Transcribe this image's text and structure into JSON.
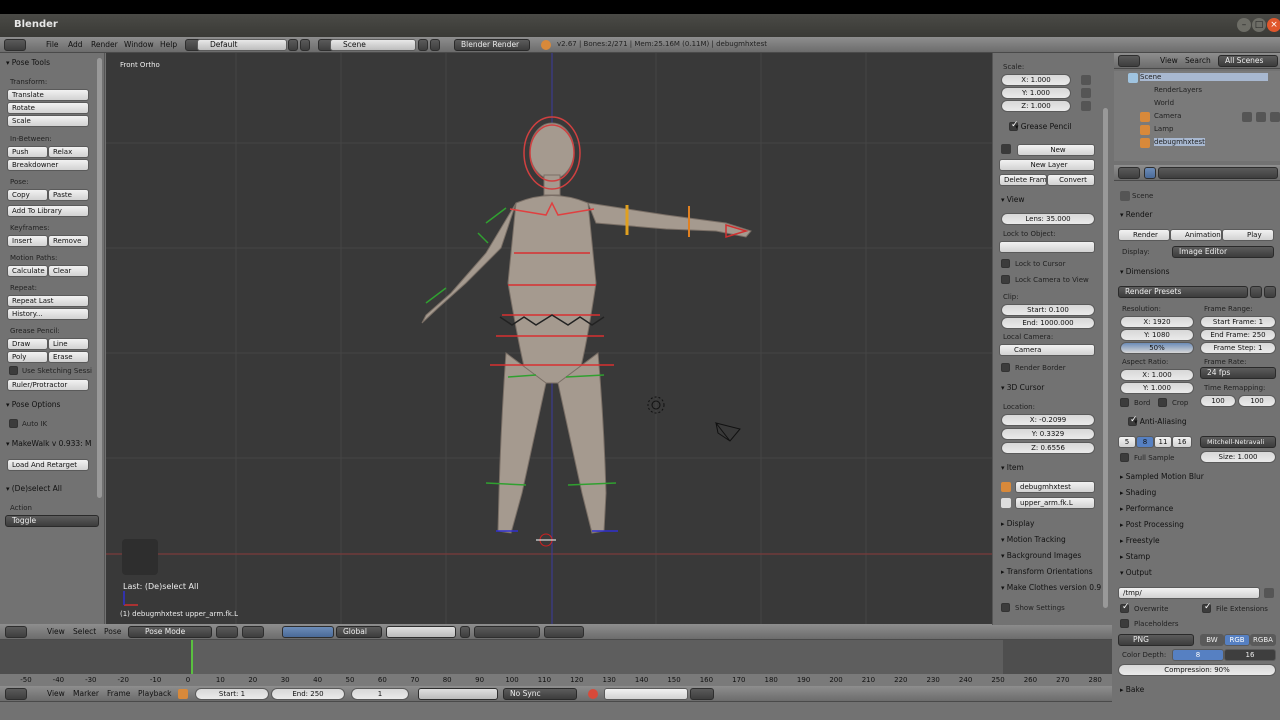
{
  "window": {
    "title": "Blender"
  },
  "info": {
    "editor_icon": "info-icon",
    "menus": [
      "File",
      "Add",
      "Render",
      "Window",
      "Help"
    ],
    "screen": "Default",
    "scene": "Scene",
    "engine": "Blender Render",
    "stats": "v2.67 | Bones:2/271 | Mem:25.16M (0.11M) | debugmhxtest"
  },
  "tools": {
    "pose_tools": "Pose Tools",
    "transform_label": "Transform:",
    "translate": "Translate",
    "rotate": "Rotate",
    "scale": "Scale",
    "inbetween_label": "In-Between:",
    "push": "Push",
    "relax": "Relax",
    "breakdowner": "Breakdowner",
    "pose_label": "Pose:",
    "copy": "Copy",
    "paste": "Paste",
    "add_to_library": "Add To Library",
    "keyframes_label": "Keyframes:",
    "insert": "Insert",
    "remove": "Remove",
    "motion_paths_label": "Motion Paths:",
    "calculate": "Calculate",
    "clear": "Clear",
    "repeat_label": "Repeat:",
    "repeat_last": "Repeat Last",
    "history": "History...",
    "grease_pencil_label": "Grease Pencil:",
    "draw": "Draw",
    "line": "Line",
    "poly": "Poly",
    "erase": "Erase",
    "use_sketching": "Use Sketching Sessi",
    "ruler": "Ruler/Protractor",
    "pose_options": "Pose Options",
    "auto_ik": "Auto IK",
    "makewalk": "MakeWalk v 0.933: M",
    "load_retarget": "Load And Retarget",
    "deselect_all": "(De)select All",
    "action_label": "Action",
    "action_value": "Toggle"
  },
  "viewport": {
    "view_name": "Front Ortho",
    "last_op": "Last: (De)select All",
    "active": "(1) debugmhxtest upper_arm.fk.L"
  },
  "viewport_header": {
    "menus": [
      "View",
      "Select",
      "Pose"
    ],
    "mode": "Pose Mode",
    "orientation": "Global"
  },
  "npanel": {
    "scale_label": "Scale:",
    "scale_x": "X: 1.000",
    "scale_y": "Y: 1.000",
    "scale_z": "Z: 1.000",
    "grease_pencil": "Grease Pencil",
    "new": "New",
    "new_layer": "New Layer",
    "delete_frame": "Delete Frame",
    "convert": "Convert",
    "view": "View",
    "lens": "Lens: 35.000",
    "lock_to_object": "Lock to Object:",
    "lock_to_cursor": "Lock to Cursor",
    "lock_camera": "Lock Camera to View",
    "clip_label": "Clip:",
    "clip_start": "Start: 0.100",
    "clip_end": "End: 1000.000",
    "local_camera_label": "Local Camera:",
    "local_camera": "Camera",
    "render_border": "Render Border",
    "cursor": "3D Cursor",
    "location_label": "Location:",
    "loc_x": "X: -0.2099",
    "loc_y": "Y: 0.3329",
    "loc_z": "Z: 0.6556",
    "item": "Item",
    "item_object": "debugmhxtest",
    "item_bone": "upper_arm.fk.L",
    "display": "Display",
    "motion_tracking": "Motion Tracking",
    "background_images": "Background Images",
    "transform_orientations": "Transform Orientations",
    "make_clothes": "Make Clothes version 0.9",
    "show_settings": "Show Settings"
  },
  "outliner": {
    "menus": [
      "View",
      "Search"
    ],
    "filter": "All Scenes",
    "items": [
      "Scene",
      "RenderLayers",
      "World",
      "Camera",
      "Lamp",
      "debugmhxtest"
    ]
  },
  "properties": {
    "breadcrumb": "Scene",
    "render": "Render",
    "render_btn": "Render",
    "animation_btn": "Animation",
    "play_btn": "Play",
    "display_label": "Display:",
    "display_value": "Image Editor",
    "dimensions": "Dimensions",
    "render_presets": "Render Presets",
    "resolution_label": "Resolution:",
    "res_x": "X: 1920",
    "res_y": "Y: 1080",
    "res_pct": "50%",
    "frame_range_label": "Frame Range:",
    "start_frame": "Start Frame: 1",
    "end_frame": "End Frame: 250",
    "frame_step": "Frame Step: 1",
    "aspect_label": "Aspect Ratio:",
    "asp_x": "X: 1.000",
    "asp_y": "Y: 1.000",
    "frame_rate_label": "Frame Rate:",
    "frame_rate": "24 fps",
    "bord": "Bord",
    "crop": "Crop",
    "time_remap_label": "Time Remapping:",
    "remap_old": "100",
    "remap_new": "100",
    "anti_aliasing": "Anti-Aliasing",
    "aa_samples": [
      "5",
      "8",
      "11",
      "16"
    ],
    "aa_filter": "Mitchell-Netravali",
    "full_sample": "Full Sample",
    "aa_size": "Size: 1.000",
    "sampled_motion_blur": "Sampled Motion Blur",
    "shading": "Shading",
    "performance": "Performance",
    "post_processing": "Post Processing",
    "freestyle": "Freestyle",
    "stamp": "Stamp",
    "output": "Output",
    "output_path": "/tmp/",
    "overwrite": "Overwrite",
    "file_extensions": "File Extensions",
    "placeholders": "Placeholders",
    "format": "PNG",
    "bw": "BW",
    "rgb": "RGB",
    "rgba": "RGBA",
    "color_depth_label": "Color Depth:",
    "depth_8": "8",
    "depth_16": "16",
    "compression": "Compression: 90%",
    "bake": "Bake"
  },
  "timeline": {
    "ticks": [
      "-50",
      "-40",
      "-30",
      "-20",
      "-10",
      "0",
      "10",
      "20",
      "30",
      "40",
      "50",
      "60",
      "70",
      "80",
      "90",
      "100",
      "110",
      "120",
      "130",
      "140",
      "150",
      "160",
      "170",
      "180",
      "190",
      "200",
      "210",
      "220",
      "230",
      "240",
      "250",
      "260",
      "270",
      "280"
    ],
    "menus": [
      "View",
      "Marker",
      "Frame",
      "Playback"
    ],
    "start": "Start: 1",
    "end": "End: 250",
    "current": "1",
    "sync": "No Sync"
  }
}
